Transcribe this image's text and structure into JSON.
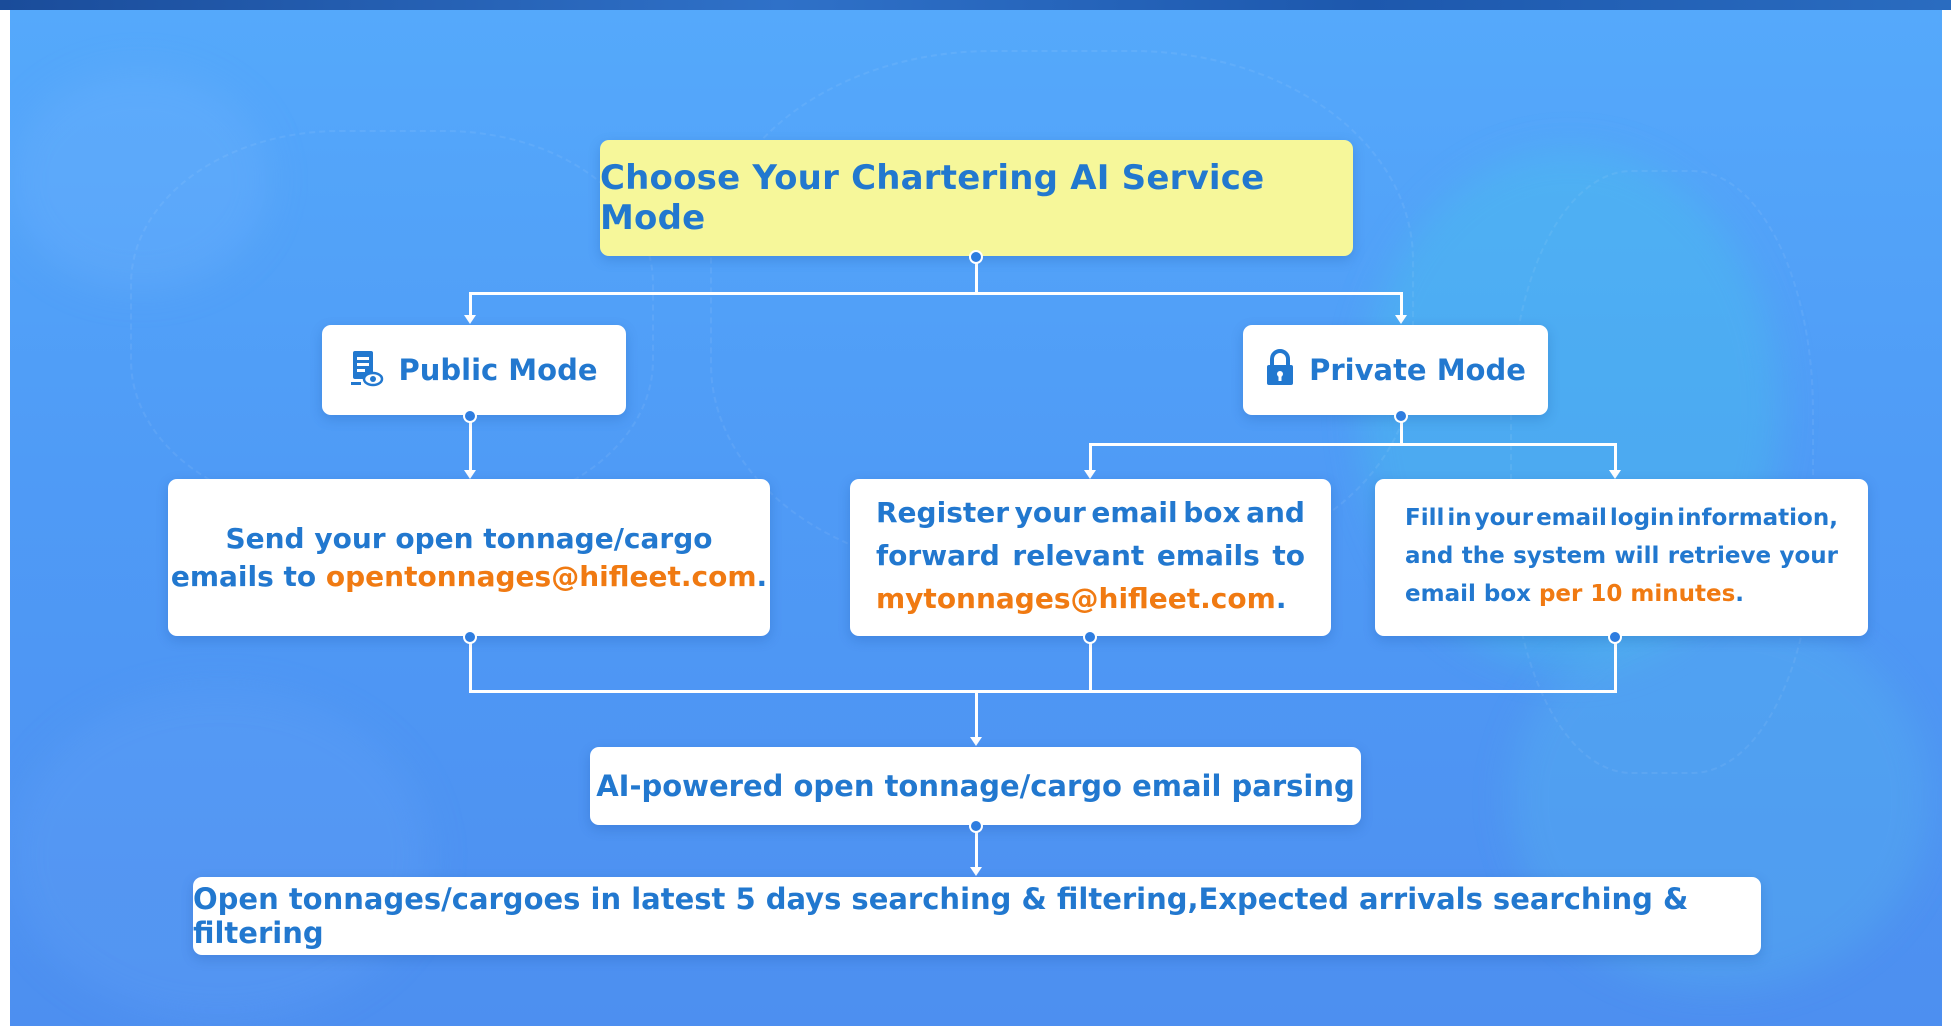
{
  "title": "Choose Your Chartering AI Service Mode",
  "public_mode": {
    "label": "Public Mode",
    "icon": "document-eye-icon",
    "description_line1": "Send your open tonnage/cargo",
    "description_prefix": "emails to ",
    "email": "opentonnages@hifleet.com",
    "description_suffix": "."
  },
  "private_mode": {
    "label": "Private Mode",
    "icon": "lock-icon",
    "register": {
      "line1_words": [
        "Register",
        "your",
        "email",
        "box",
        "and"
      ],
      "line2_words": [
        "forward",
        "relevant",
        "emails",
        "to"
      ],
      "email": "mytonnages@hifleet.com",
      "suffix": "."
    },
    "fill_in": {
      "line1_words": [
        "Fill",
        "in",
        "your",
        "email",
        "login",
        "information,"
      ],
      "line2_words": [
        "and",
        "the",
        "system",
        "will",
        "retrieve",
        "your"
      ],
      "line3_prefix": "email box ",
      "line3_highlight": "per 10 minutes",
      "line3_suffix": "."
    }
  },
  "ai_parsing": "AI-powered open tonnage/cargo email parsing",
  "final_step": "Open tonnages/cargoes in latest 5 days searching & filtering,Expected arrivals searching & filtering",
  "colors": {
    "background_top": "#55a9fb",
    "background_bottom": "#4d8ff0",
    "title_box": "#f6f79a",
    "text_blue": "#2278cf",
    "text_orange": "#f07a12",
    "connector_dot": "#2e7de0"
  }
}
